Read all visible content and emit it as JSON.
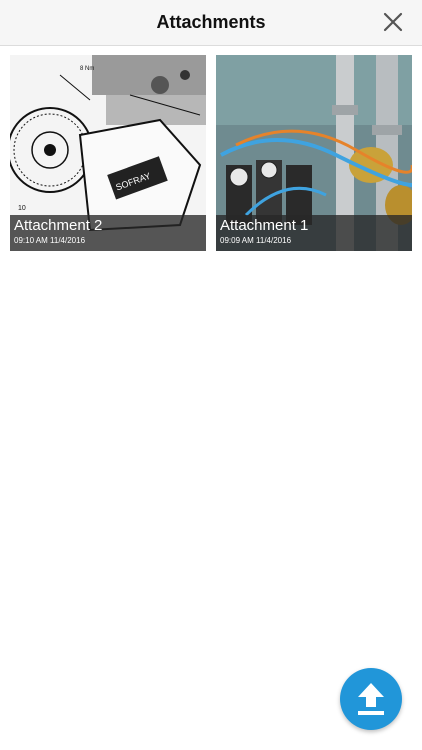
{
  "header": {
    "title": "Attachments",
    "close_icon": "close-icon"
  },
  "attachments": [
    {
      "title": "Attachment 2",
      "timestamp": "09:10 AM 11/4/2016",
      "thumbnail": "engine-diagram-icon"
    },
    {
      "title": "Attachment 1",
      "timestamp": "09:09 AM 11/4/2016",
      "thumbnail": "industrial-pipes-icon"
    }
  ],
  "fab": {
    "icon": "upload-icon",
    "color": "#2196d9"
  }
}
